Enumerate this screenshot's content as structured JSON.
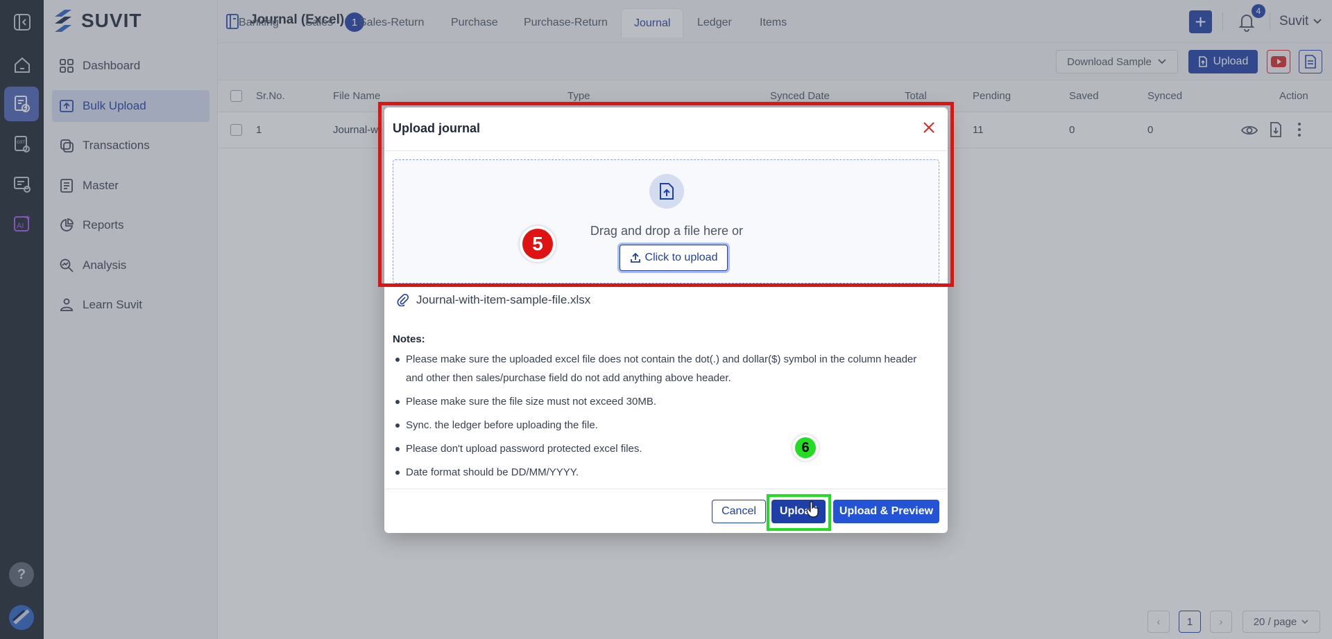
{
  "app": {
    "brand": "SUVIT",
    "page_title": "Journal (Excel)",
    "title_badge": "1",
    "notification_count": "4",
    "user_name": "Suvit"
  },
  "sidebar": {
    "items": [
      {
        "label": "Dashboard",
        "icon": "grid-icon"
      },
      {
        "label": "Bulk Upload",
        "icon": "upload-tray-icon",
        "active": true
      },
      {
        "label": "Transactions",
        "icon": "transactions-icon"
      },
      {
        "label": "Master",
        "icon": "master-icon"
      },
      {
        "label": "Reports",
        "icon": "pie-chart-icon"
      },
      {
        "label": "Analysis",
        "icon": "analysis-icon"
      },
      {
        "label": "Learn Suvit",
        "icon": "learn-icon"
      }
    ]
  },
  "tabs": [
    {
      "label": "Banking"
    },
    {
      "label": "Sales"
    },
    {
      "label": "Sales-Return"
    },
    {
      "label": "Purchase"
    },
    {
      "label": "Purchase-Return"
    },
    {
      "label": "Journal",
      "active": true
    },
    {
      "label": "Ledger"
    },
    {
      "label": "Items"
    }
  ],
  "toolbar": {
    "download_sample": "Download Sample",
    "upload": "Upload"
  },
  "table": {
    "columns": [
      "Sr.No.",
      "File Name",
      "Type",
      "Synced Date",
      "Total",
      "Pending",
      "Saved",
      "Synced",
      "Action"
    ],
    "rows": [
      {
        "sr": "1",
        "file": "Journal-w",
        "pending": "11",
        "saved": "0",
        "synced": "0"
      }
    ]
  },
  "pagination": {
    "current_page": "1",
    "page_size": "20 / page"
  },
  "modal": {
    "title": "Upload journal",
    "drop_text": "Drag and drop a file here or",
    "click_upload": "Click to upload",
    "file_name": "Journal-with-item-sample-file.xlsx",
    "notes_title": "Notes:",
    "notes": [
      "Please make sure the uploaded excel file does not contain the dot(.) and dollar($) symbol in the column header and other then sales/purchase field do not add anything above header.",
      "Please make sure the file size must not exceed 30MB.",
      "Sync. the ledger before uploading the file.",
      "Please don't upload password protected excel files.",
      "Date format should be DD/MM/YYYY."
    ],
    "cancel": "Cancel",
    "upload": "Upload",
    "upload_preview": "Upload & Preview"
  },
  "annotations": {
    "step_a": "5",
    "step_b": "6",
    "highlight_red": "#e11212",
    "highlight_green": "#22dd22"
  },
  "colors": {
    "primary": "#1e3fa8",
    "rail_bg": "#1c232f",
    "sidebar_active_bg": "#d4dcf0"
  }
}
